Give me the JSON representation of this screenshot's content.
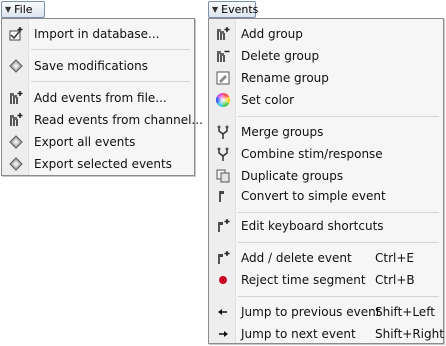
{
  "file_menu": {
    "button_label": "File",
    "items": [
      {
        "label": "Import in database...",
        "icon": "import-database-icon"
      },
      {
        "label": "Save modifications",
        "icon": "save-diamond-icon"
      },
      {
        "label": "Add events from file...",
        "icon": "add-events-file-icon"
      },
      {
        "label": "Read events from channel...",
        "icon": "read-events-channel-icon"
      },
      {
        "label": "Export all events",
        "icon": "export-diamond-icon"
      },
      {
        "label": "Export selected events",
        "icon": "export-selected-diamond-icon"
      }
    ]
  },
  "events_menu": {
    "button_label": "Events",
    "items": [
      {
        "label": "Add group",
        "icon": "add-group-icon"
      },
      {
        "label": "Delete group",
        "icon": "delete-group-icon"
      },
      {
        "label": "Rename group",
        "icon": "rename-group-icon"
      },
      {
        "label": "Set color",
        "icon": "color-wheel-icon"
      },
      {
        "label": "Merge groups",
        "icon": "merge-groups-icon"
      },
      {
        "label": "Combine stim/response",
        "icon": "combine-icon"
      },
      {
        "label": "Duplicate groups",
        "icon": "duplicate-icon"
      },
      {
        "label": "Convert to simple event",
        "icon": "flag-icon"
      },
      {
        "label": "Edit keyboard shortcuts",
        "icon": "flag-plus-icon"
      },
      {
        "label": "Add / delete event",
        "shortcut": "Ctrl+E",
        "icon": "flag-plus-icon"
      },
      {
        "label": "Reject time segment",
        "shortcut": "Ctrl+B",
        "icon": "red-dot-icon"
      },
      {
        "label": "Jump to previous event",
        "shortcut": "Shift+Left",
        "icon": "arrow-left-icon"
      },
      {
        "label": "Jump to next event",
        "shortcut": "Shift+Right",
        "icon": "arrow-right-icon"
      }
    ]
  },
  "colors": {
    "reject_dot": "#cc0022",
    "menu_border": "#8c8c8c",
    "gutter": "#eeeeee"
  }
}
